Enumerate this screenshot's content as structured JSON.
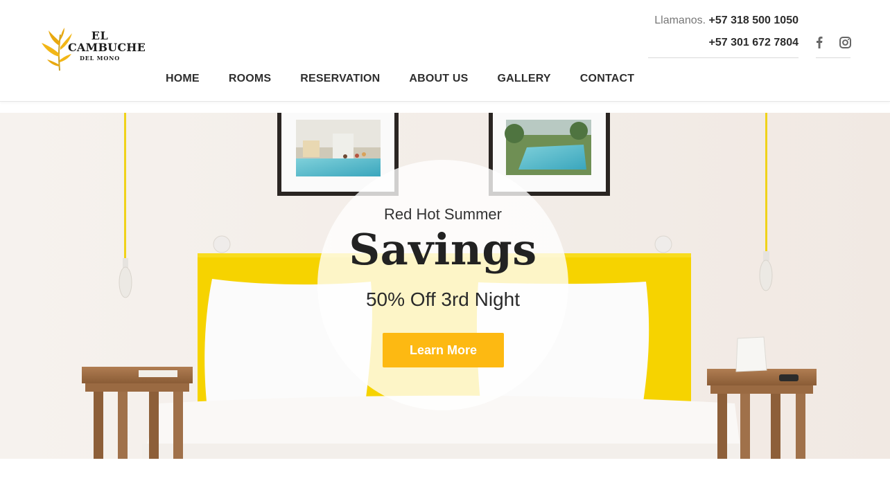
{
  "header": {
    "logo": {
      "line1": "EL",
      "line2": "CAMBUCHE",
      "line3": "DEL MONO"
    },
    "contact": {
      "prefix": "Llamanos.",
      "phone1": "+57 318 500 1050",
      "phone2": "+57 301 672 7804"
    },
    "social": [
      {
        "icon": "facebook-icon"
      },
      {
        "icon": "instagram-icon"
      }
    ],
    "nav": [
      "HOME",
      "ROOMS",
      "RESERVATION",
      "ABOUT US",
      "GALLERY",
      "CONTACT"
    ]
  },
  "hero": {
    "subtitle": "Red Hot Summer",
    "title": "Savings",
    "offer": "50% Off 3rd Night",
    "button_label": "Learn More"
  },
  "colors": {
    "accent": "#fdb912",
    "headboard": "#f5d400",
    "text_dark": "#222222"
  }
}
